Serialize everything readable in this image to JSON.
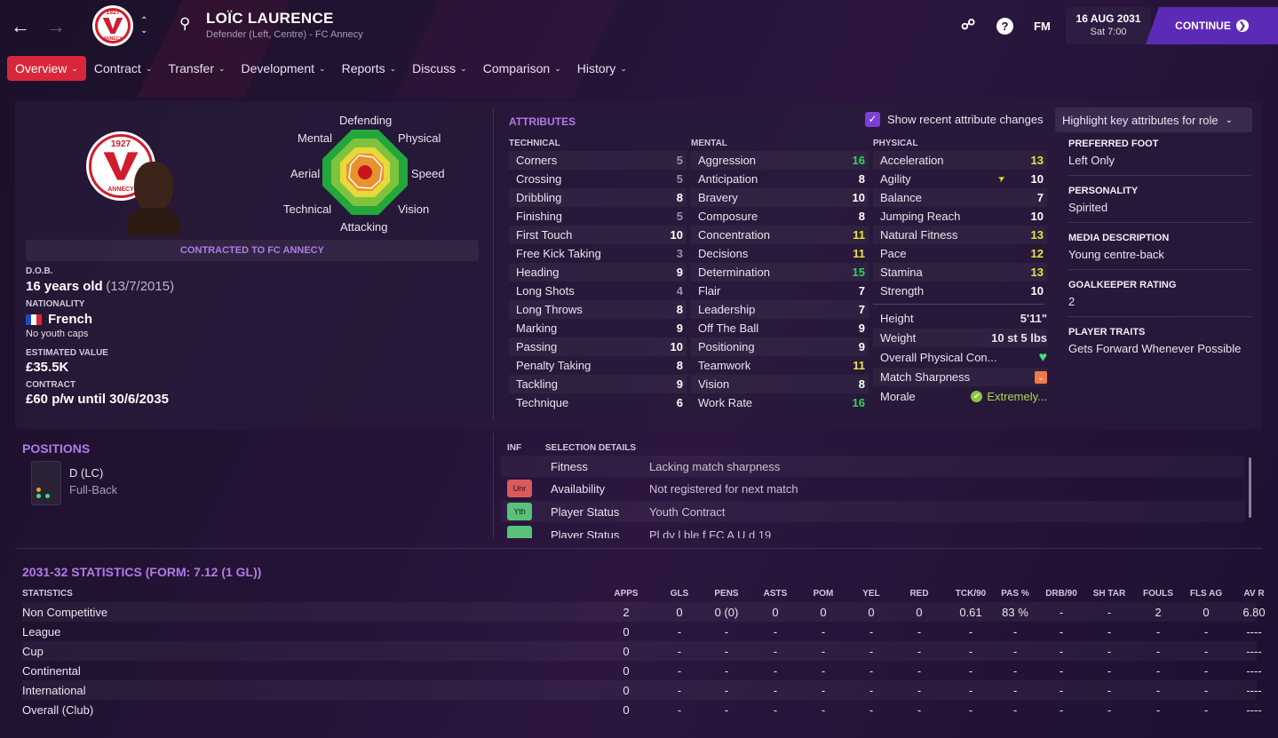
{
  "header": {
    "player_name": "LOÏC LAURENCE",
    "subtitle": "Defender (Left, Centre) - FC Annecy",
    "crest_year": "1927",
    "crest_text": "ANNECY",
    "date": "16 AUG 2031",
    "time": "Sat 7:00",
    "continue_label": "CONTINUE",
    "fm_label": "FM"
  },
  "tabs": [
    {
      "label": "Overview"
    },
    {
      "label": "Contract"
    },
    {
      "label": "Transfer"
    },
    {
      "label": "Development"
    },
    {
      "label": "Reports"
    },
    {
      "label": "Discuss"
    },
    {
      "label": "Comparison"
    },
    {
      "label": "History"
    }
  ],
  "profile": {
    "polar_labels": {
      "defending": "Defending",
      "physical": "Physical",
      "speed": "Speed",
      "vision": "Vision",
      "attacking": "Attacking",
      "technical": "Technical",
      "aerial": "Aerial",
      "mental": "Mental"
    },
    "contract_banner": "CONTRACTED TO FC ANNECY",
    "dob_label": "D.O.B.",
    "age": "16 years old",
    "dob": "(13/7/2015)",
    "nationality_label": "NATIONALITY",
    "nationality": "French",
    "youth_caps": "No youth caps",
    "value_label": "ESTIMATED VALUE",
    "value": "£35.5K",
    "contract_label": "CONTRACT",
    "contract": "£60 p/w until 30/6/2035"
  },
  "attributes": {
    "title": "ATTRIBUTES",
    "show_changes_label": "Show recent attribute changes",
    "highlight_label": "Highlight key attributes for role",
    "technical_head": "TECHNICAL",
    "mental_head": "MENTAL",
    "physical_head": "PHYSICAL",
    "technical": [
      {
        "name": "Corners",
        "value": "5"
      },
      {
        "name": "Crossing",
        "value": "5"
      },
      {
        "name": "Dribbling",
        "value": "8"
      },
      {
        "name": "Finishing",
        "value": "5"
      },
      {
        "name": "First Touch",
        "value": "10"
      },
      {
        "name": "Free Kick Taking",
        "value": "3"
      },
      {
        "name": "Heading",
        "value": "9"
      },
      {
        "name": "Long Shots",
        "value": "4"
      },
      {
        "name": "Long Throws",
        "value": "8"
      },
      {
        "name": "Marking",
        "value": "9"
      },
      {
        "name": "Passing",
        "value": "10"
      },
      {
        "name": "Penalty Taking",
        "value": "8"
      },
      {
        "name": "Tackling",
        "value": "9"
      },
      {
        "name": "Technique",
        "value": "6"
      }
    ],
    "mental": [
      {
        "name": "Aggression",
        "value": "16"
      },
      {
        "name": "Anticipation",
        "value": "8"
      },
      {
        "name": "Bravery",
        "value": "10"
      },
      {
        "name": "Composure",
        "value": "8"
      },
      {
        "name": "Concentration",
        "value": "11"
      },
      {
        "name": "Decisions",
        "value": "11"
      },
      {
        "name": "Determination",
        "value": "15"
      },
      {
        "name": "Flair",
        "value": "7"
      },
      {
        "name": "Leadership",
        "value": "7"
      },
      {
        "name": "Off The Ball",
        "value": "9"
      },
      {
        "name": "Positioning",
        "value": "9"
      },
      {
        "name": "Teamwork",
        "value": "11"
      },
      {
        "name": "Vision",
        "value": "8"
      },
      {
        "name": "Work Rate",
        "value": "16"
      }
    ],
    "physical": [
      {
        "name": "Acceleration",
        "value": "13"
      },
      {
        "name": "Agility",
        "value": "10"
      },
      {
        "name": "Balance",
        "value": "7"
      },
      {
        "name": "Jumping Reach",
        "value": "10"
      },
      {
        "name": "Natural Fitness",
        "value": "13"
      },
      {
        "name": "Pace",
        "value": "12"
      },
      {
        "name": "Stamina",
        "value": "13"
      },
      {
        "name": "Strength",
        "value": "10"
      }
    ],
    "height_label": "Height",
    "height": "5'11\"",
    "weight_label": "Weight",
    "weight": "10 st 5 lbs",
    "condition_label": "Overall Physical Con...",
    "sharpness_label": "Match Sharpness",
    "morale_label": "Morale",
    "morale": "Extremely..."
  },
  "side_info": {
    "foot_label": "PREFERRED FOOT",
    "foot": "Left Only",
    "personality_label": "PERSONALITY",
    "personality": "Spirited",
    "media_label": "MEDIA DESCRIPTION",
    "media": "Young centre-back",
    "gk_label": "GOALKEEPER RATING",
    "gk": "2",
    "traits_label": "PLAYER TRAITS",
    "traits": "Gets Forward Whenever Possible"
  },
  "positions": {
    "title": "POSITIONS",
    "position": "D (LC)",
    "role": "Full-Back"
  },
  "selection": {
    "inf_head": "INF",
    "details_head": "SELECTION DETAILS",
    "rows": [
      {
        "badge": "",
        "label": "Fitness",
        "value": "Lacking match sharpness"
      },
      {
        "badge": "Unr",
        "label": "Availability",
        "value": "Not registered for next match"
      },
      {
        "badge": "Yth",
        "label": "Player Status",
        "value": "Youth Contract"
      },
      {
        "badge": "",
        "label": "Player Status",
        "value": "Pl    dy   l  ble f  FC A    U d  19"
      }
    ]
  },
  "stats": {
    "title": "2031-32 STATISTICS (FORM: 7.12 (1 GL))",
    "columns": [
      "STATISTICS",
      "APPS",
      "GLS",
      "PENS",
      "ASTS",
      "POM",
      "YEL",
      "RED",
      "TCK/90",
      "PAS %",
      "DRB/90",
      "SH TAR",
      "FOULS",
      "FLS AG",
      "AV R"
    ],
    "rows": [
      [
        "Non Competitive",
        "2",
        "0",
        "0 (0)",
        "0",
        "0",
        "0",
        "0",
        "0.61",
        "83 %",
        "-",
        "-",
        "2",
        "0",
        "6.80"
      ],
      [
        "League",
        "0",
        "-",
        "-",
        "-",
        "-",
        "-",
        "-",
        "-",
        "-",
        "-",
        "-",
        "-",
        "-",
        "----"
      ],
      [
        "Cup",
        "0",
        "-",
        "-",
        "-",
        "-",
        "-",
        "-",
        "-",
        "-",
        "-",
        "-",
        "-",
        "-",
        "----"
      ],
      [
        "Continental",
        "0",
        "-",
        "-",
        "-",
        "-",
        "-",
        "-",
        "-",
        "-",
        "-",
        "-",
        "-",
        "-",
        "----"
      ],
      [
        "International",
        "0",
        "-",
        "-",
        "-",
        "-",
        "-",
        "-",
        "-",
        "-",
        "-",
        "-",
        "-",
        "-",
        "----"
      ],
      [
        "Overall (Club)",
        "0",
        "-",
        "-",
        "-",
        "-",
        "-",
        "-",
        "-",
        "-",
        "-",
        "-",
        "-",
        "-",
        "----"
      ]
    ]
  },
  "colors": {
    "accent": "#d8263a",
    "purple": "#b07ae8",
    "green_attr": "#34d35c",
    "yellow_attr": "#e9e33a",
    "grey_attr": "#9a93a5"
  }
}
